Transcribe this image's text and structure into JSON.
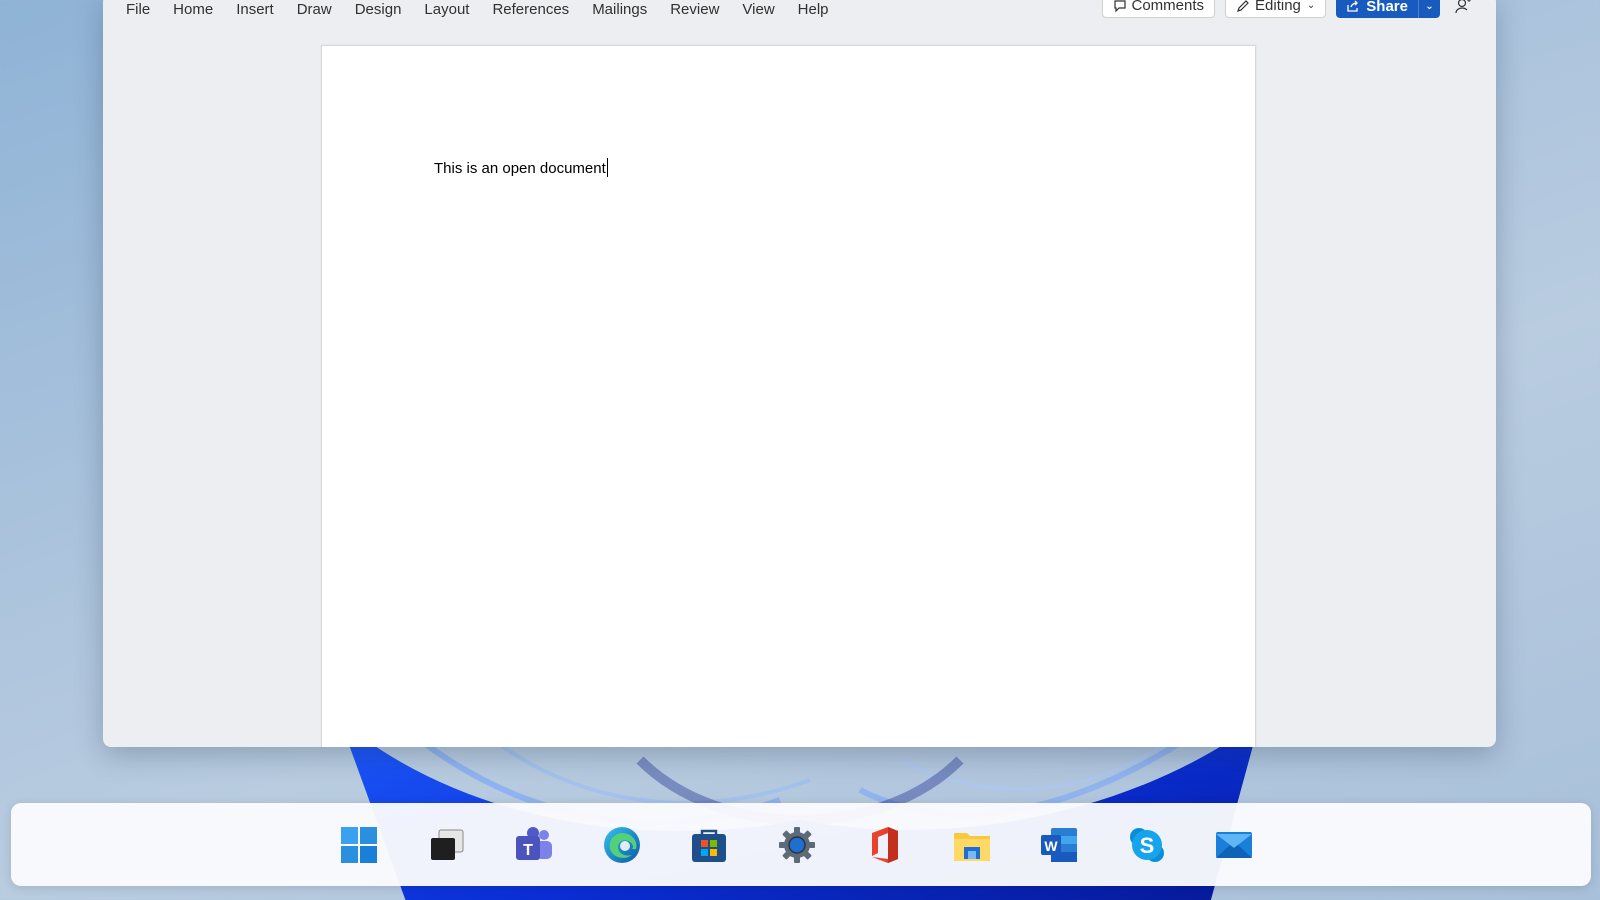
{
  "ribbon": {
    "tabs": [
      "File",
      "Home",
      "Insert",
      "Draw",
      "Design",
      "Layout",
      "References",
      "Mailings",
      "Review",
      "View",
      "Help"
    ],
    "comments_label": "Comments",
    "editing_label": "Editing",
    "share_label": "Share"
  },
  "document": {
    "text": "This is an open document"
  },
  "taskbar": {
    "apps": [
      "start-icon",
      "task-view-icon",
      "teams-icon",
      "edge-icon",
      "store-icon",
      "settings-icon",
      "office-icon",
      "file-explorer-icon",
      "word-icon",
      "skype-icon",
      "mail-icon"
    ]
  },
  "colors": {
    "accent": "#185abd",
    "window_bg": "#eceef2",
    "page_bg": "#ffffff",
    "wallpaper": "#a9c2dc"
  }
}
